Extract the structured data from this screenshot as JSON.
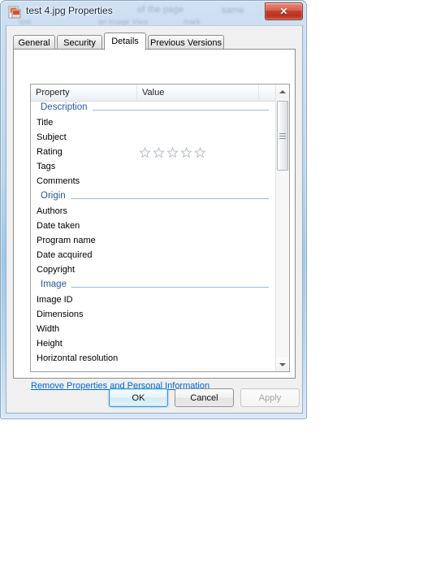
{
  "window": {
    "title": "test 4.jpg Properties",
    "icon": "jpg-file-icon",
    "close_label": "✕",
    "ghost_text": {
      "a": "of the page",
      "b": "same",
      "c": "an image View",
      "d": "mark",
      "e": "test"
    }
  },
  "tabs": [
    {
      "label": "General",
      "active": false
    },
    {
      "label": "Security",
      "active": false
    },
    {
      "label": "Details",
      "active": true
    },
    {
      "label": "Previous Versions",
      "active": false
    }
  ],
  "list": {
    "columns": [
      "Property",
      "Value"
    ],
    "groups": [
      {
        "name": "Description",
        "rows": [
          {
            "name": "Title",
            "value": ""
          },
          {
            "name": "Subject",
            "value": ""
          },
          {
            "name": "Rating",
            "value": "",
            "widget": "star-rating",
            "stars_filled": 0,
            "stars_total": 5
          },
          {
            "name": "Tags",
            "value": ""
          },
          {
            "name": "Comments",
            "value": ""
          }
        ]
      },
      {
        "name": "Origin",
        "rows": [
          {
            "name": "Authors",
            "value": ""
          },
          {
            "name": "Date taken",
            "value": ""
          },
          {
            "name": "Program name",
            "value": ""
          },
          {
            "name": "Date acquired",
            "value": ""
          },
          {
            "name": "Copyright",
            "value": ""
          }
        ]
      },
      {
        "name": "Image",
        "rows": [
          {
            "name": "Image ID",
            "value": ""
          },
          {
            "name": "Dimensions",
            "value": ""
          },
          {
            "name": "Width",
            "value": ""
          },
          {
            "name": "Height",
            "value": ""
          },
          {
            "name": "Horizontal resolution",
            "value": "",
            "clipped": true
          }
        ]
      }
    ]
  },
  "link": {
    "remove_properties": "Remove Properties and Personal Information"
  },
  "buttons": {
    "ok": "OK",
    "cancel": "Cancel",
    "apply": "Apply"
  },
  "colors": {
    "accent_link": "#0066cc",
    "group_heading": "#2b5797",
    "close_red": "#c1402c",
    "default_button_border": "#3c9ad4"
  }
}
